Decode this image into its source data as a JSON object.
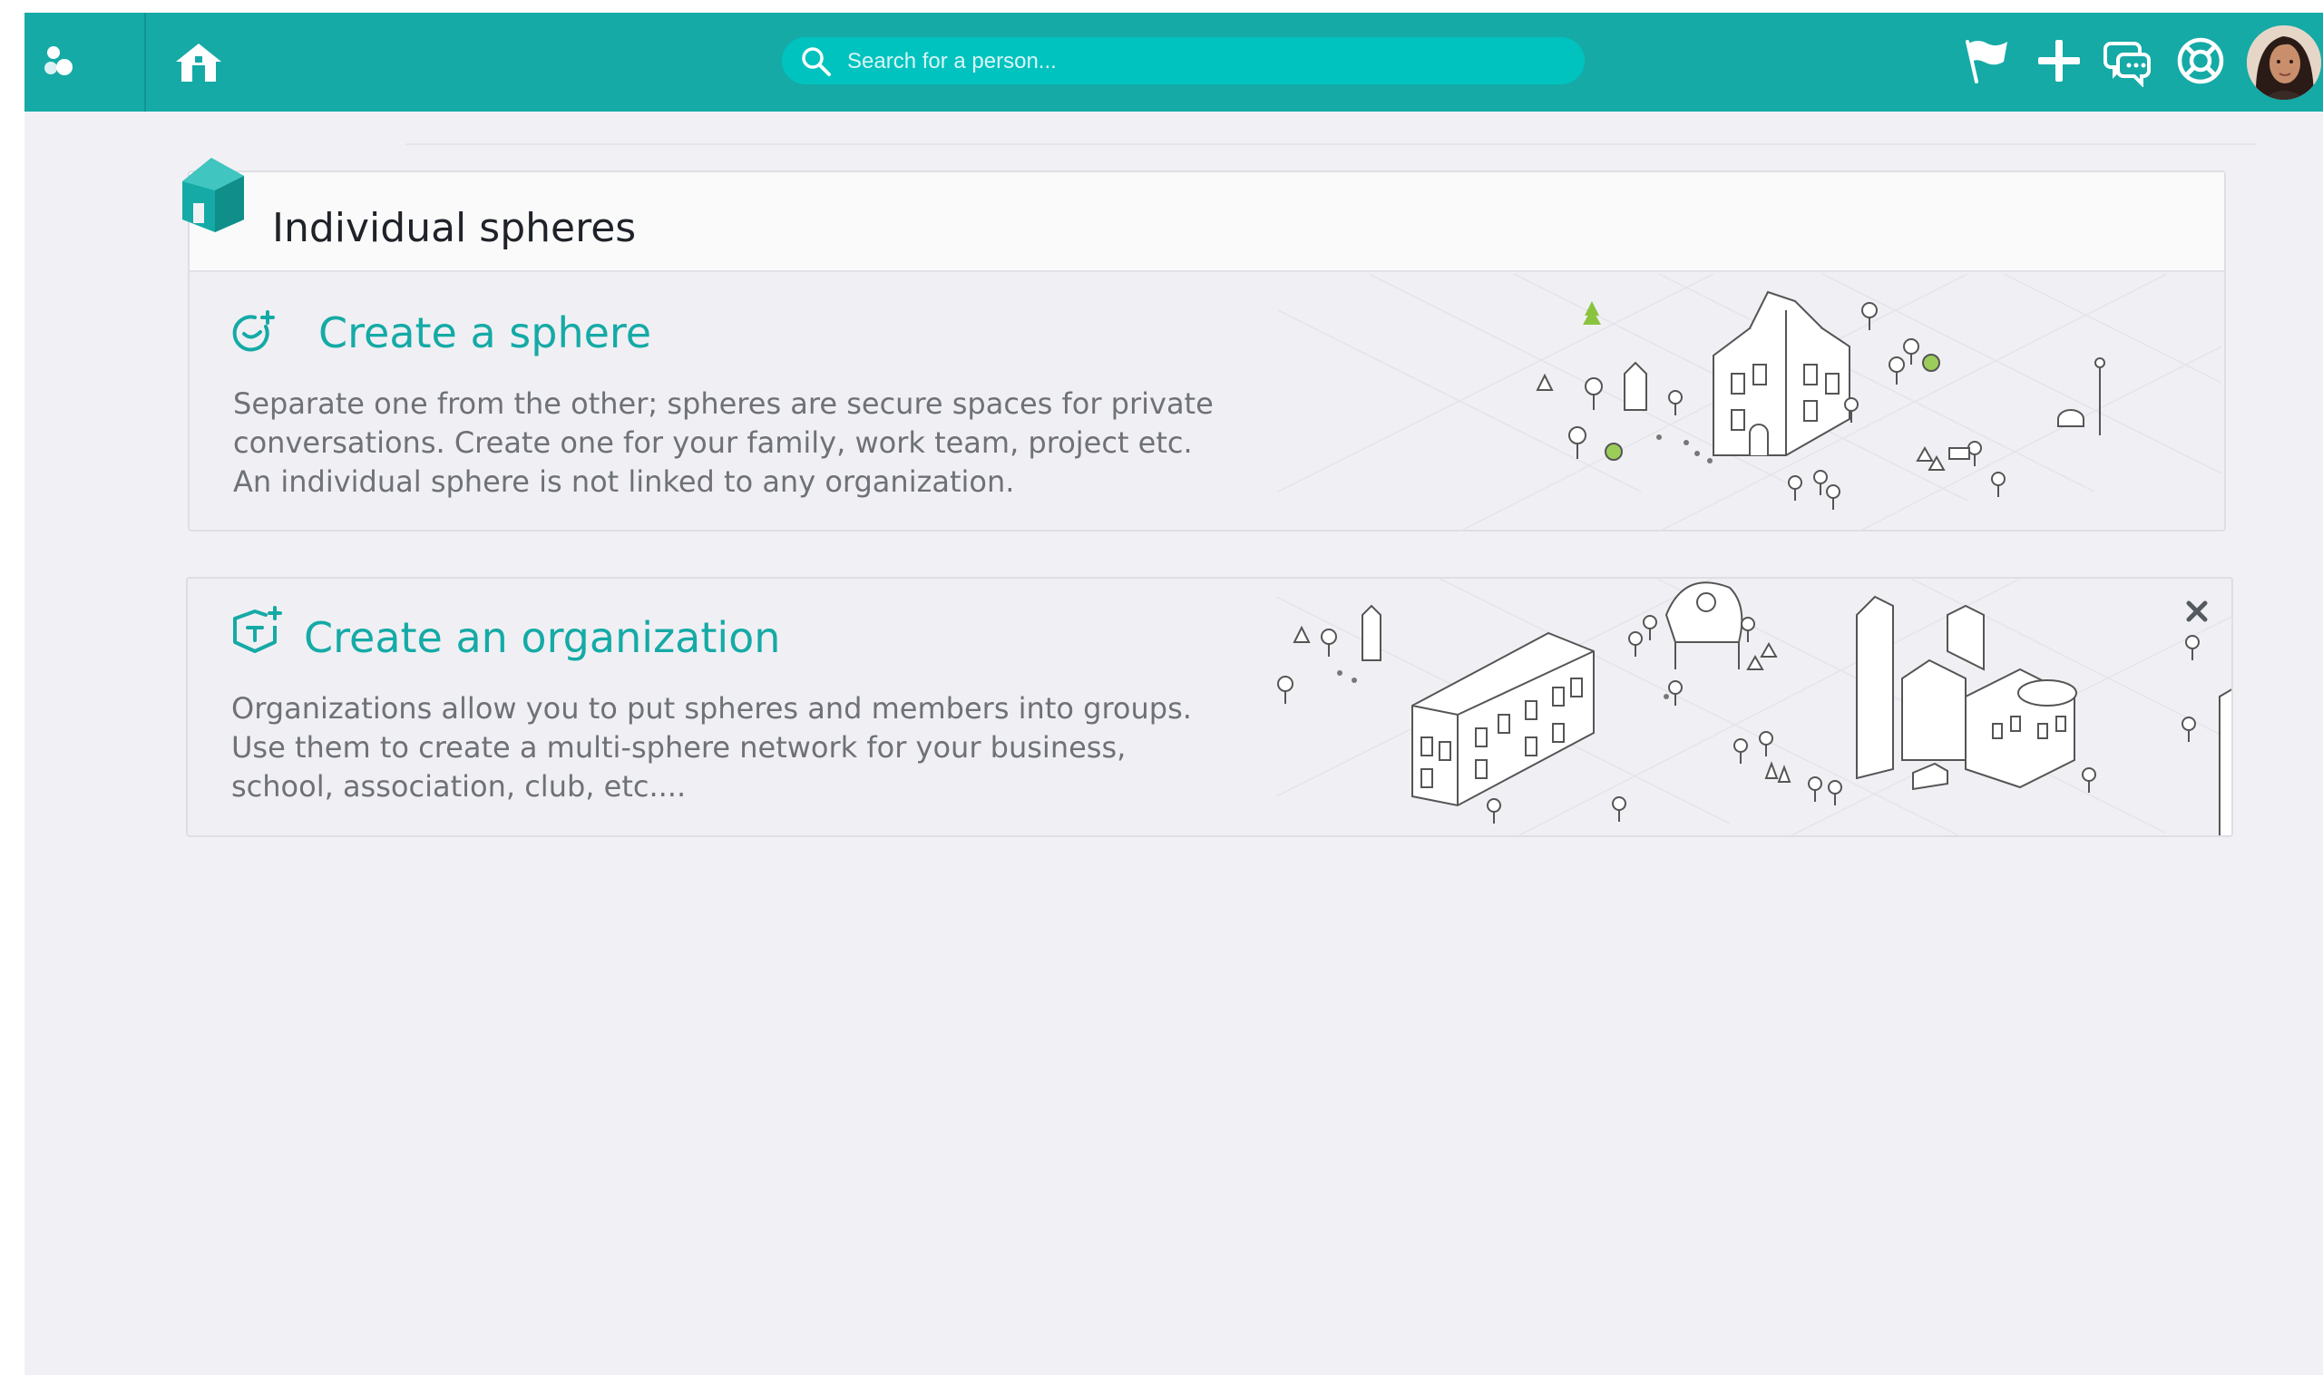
{
  "topbar": {
    "search_placeholder": "Search for a person...",
    "icons": [
      "logo-icon",
      "home-icon",
      "search-icon",
      "flag-icon",
      "plus-icon",
      "chat-icon",
      "help-icon"
    ],
    "avatar": "user-avatar"
  },
  "section": {
    "title": "Individual spheres"
  },
  "sphere_card": {
    "title": "Create a sphere",
    "description": [
      "Separate one from the other; spheres are secure spaces for private",
      "conversations. Create one for your family, work team, project etc.",
      "An individual sphere is not linked to any organization."
    ]
  },
  "org_card": {
    "title": "Create an organization",
    "description": [
      "Organizations allow you to put spheres and members into groups.",
      "Use them to create a multi-sphere network for your business,",
      "school, association, club, etc...."
    ]
  },
  "colors": {
    "brand": "#15aaa6",
    "search": "#00c3c0",
    "background": "#f1f1f5",
    "text_dark": "#1f2329",
    "text_muted": "#6e7177"
  }
}
